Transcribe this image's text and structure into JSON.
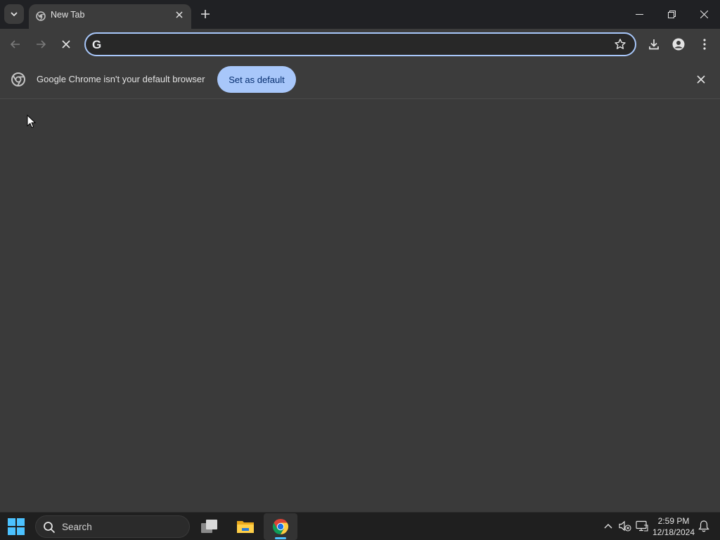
{
  "tabstrip": {
    "tab_title": "New Tab"
  },
  "toolbar": {
    "omnibox_value": "",
    "omnibox_logo": "G"
  },
  "infobar": {
    "message": "Google Chrome isn't your default browser",
    "button_label": "Set as default"
  },
  "taskbar": {
    "search_label": "Search",
    "time": "2:59 PM",
    "date": "12/18/2024"
  },
  "colors": {
    "accent": "#a8c7fa",
    "toolbar_bg": "#3c3c3c",
    "content_bg": "#3a3a3a",
    "taskbar_bg": "#1f1f1f"
  },
  "icons": [
    "chevron-down-icon",
    "chrome-favicon-icon",
    "close-icon",
    "plus-icon",
    "minimize-icon",
    "restore-icon",
    "back-arrow-icon",
    "forward-arrow-icon",
    "stop-loading-icon",
    "google-g-icon",
    "star-icon",
    "download-icon",
    "profile-icon",
    "menu-dots-icon",
    "chrome-logo-icon",
    "windows-start-icon",
    "search-icon",
    "task-view-icon",
    "file-explorer-icon",
    "chrome-icon",
    "chevron-up-icon",
    "speaker-muted-icon",
    "network-icon",
    "notification-bell-icon"
  ]
}
